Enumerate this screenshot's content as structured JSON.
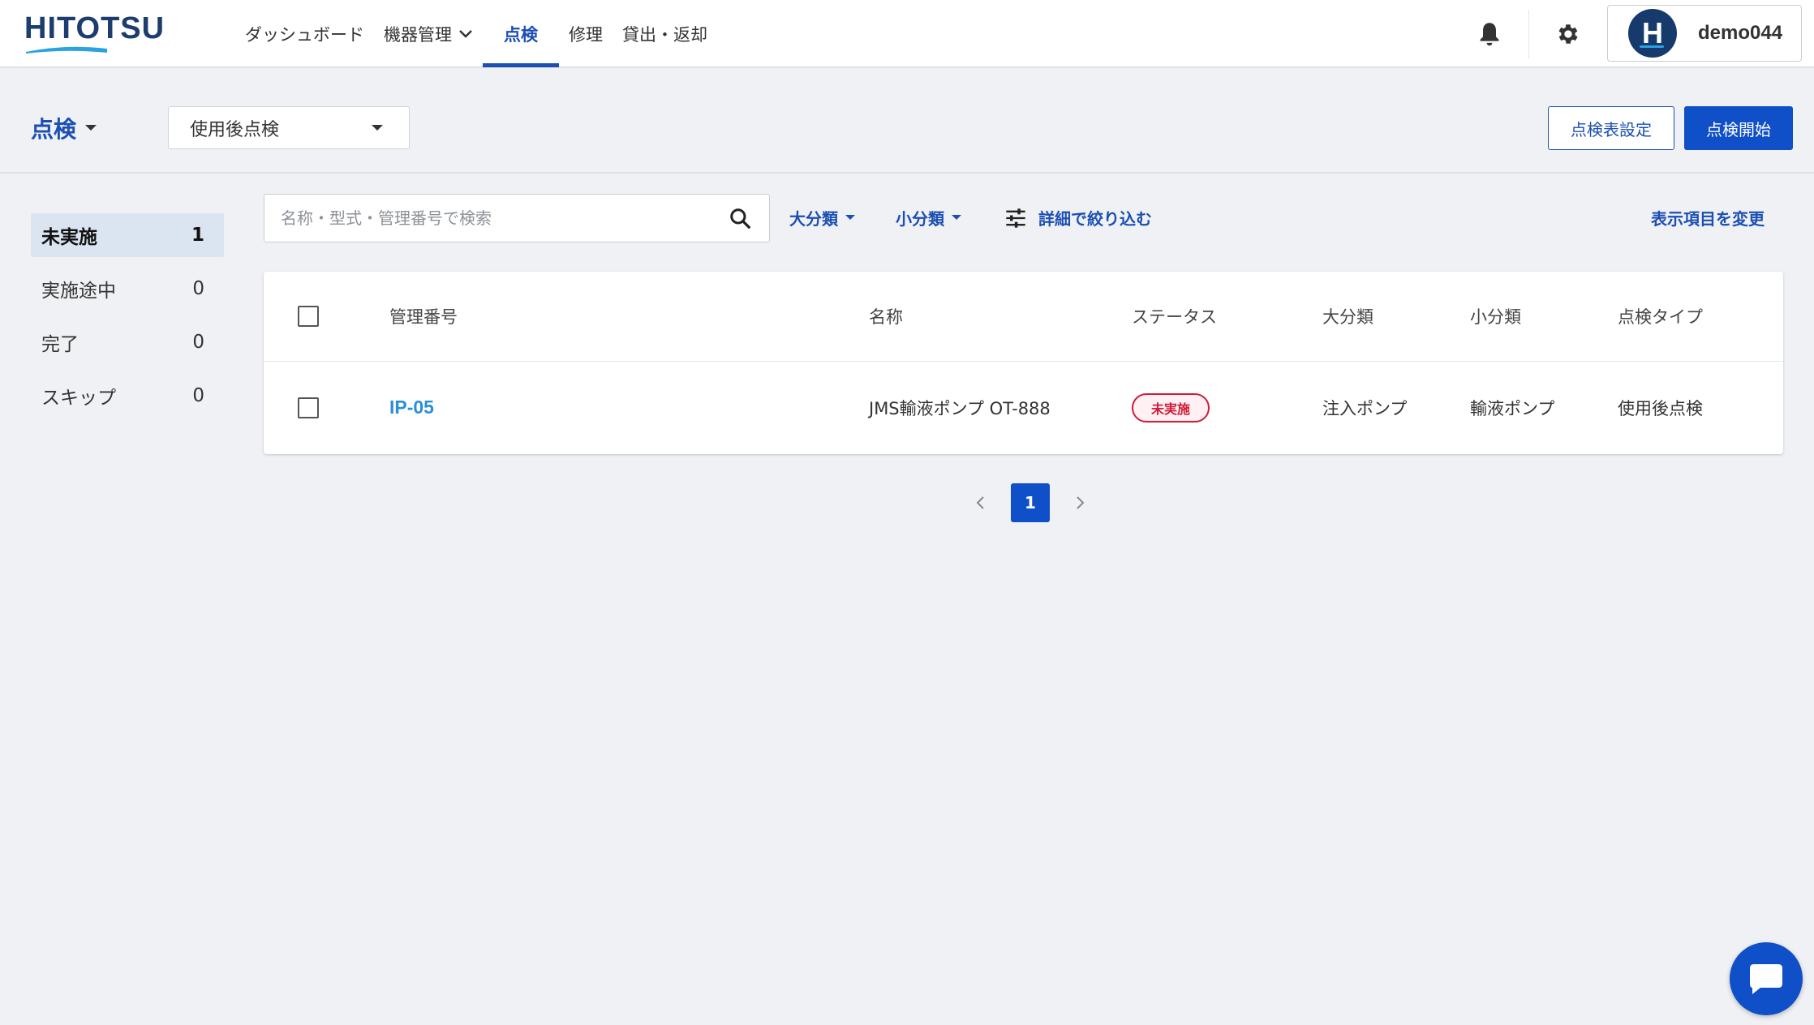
{
  "brand": {
    "logo_text": "HITOTSU",
    "primary_color": "#1b4fb3",
    "button_color": "#0f4fc8",
    "logo_color": "#1c3d6e"
  },
  "nav": {
    "items": [
      {
        "label": "ダッシュボード"
      },
      {
        "label": "機器管理",
        "has_dropdown": true
      },
      {
        "label": "点検",
        "active": true
      },
      {
        "label": "修理"
      },
      {
        "label": "貸出・返却"
      }
    ]
  },
  "header_icons": {
    "notifications": "bell-icon",
    "settings": "gear-icon"
  },
  "user": {
    "avatar_letter": "H",
    "name": "demo044"
  },
  "page": {
    "title": "点検",
    "type_select_value": "使用後点検",
    "settings_button": "点検表設定",
    "start_button": "点検開始"
  },
  "status_filters": [
    {
      "label": "未実施",
      "count": "1",
      "active": true
    },
    {
      "label": "実施途中",
      "count": "0"
    },
    {
      "label": "完了",
      "count": "0"
    },
    {
      "label": "スキップ",
      "count": "0"
    }
  ],
  "toolbar": {
    "search_placeholder": "名称・型式・管理番号で検索",
    "large_category": "大分類",
    "small_category": "小分類",
    "detail_filter": "詳細で絞り込む",
    "change_columns": "表示項目を変更"
  },
  "table": {
    "headers": {
      "id": "管理番号",
      "name": "名称",
      "status": "ステータス",
      "large_category": "大分類",
      "small_category": "小分類",
      "inspection_type": "点検タイプ"
    },
    "rows": [
      {
        "id": "IP-05",
        "name": "JMS輸液ポンプ OT-888",
        "status": "未実施",
        "large_category": "注入ポンプ",
        "small_category": "輸液ポンプ",
        "inspection_type": "使用後点検"
      }
    ]
  },
  "pagination": {
    "current_page": "1"
  },
  "status_colors": {
    "not_done": "#d11a3a"
  }
}
